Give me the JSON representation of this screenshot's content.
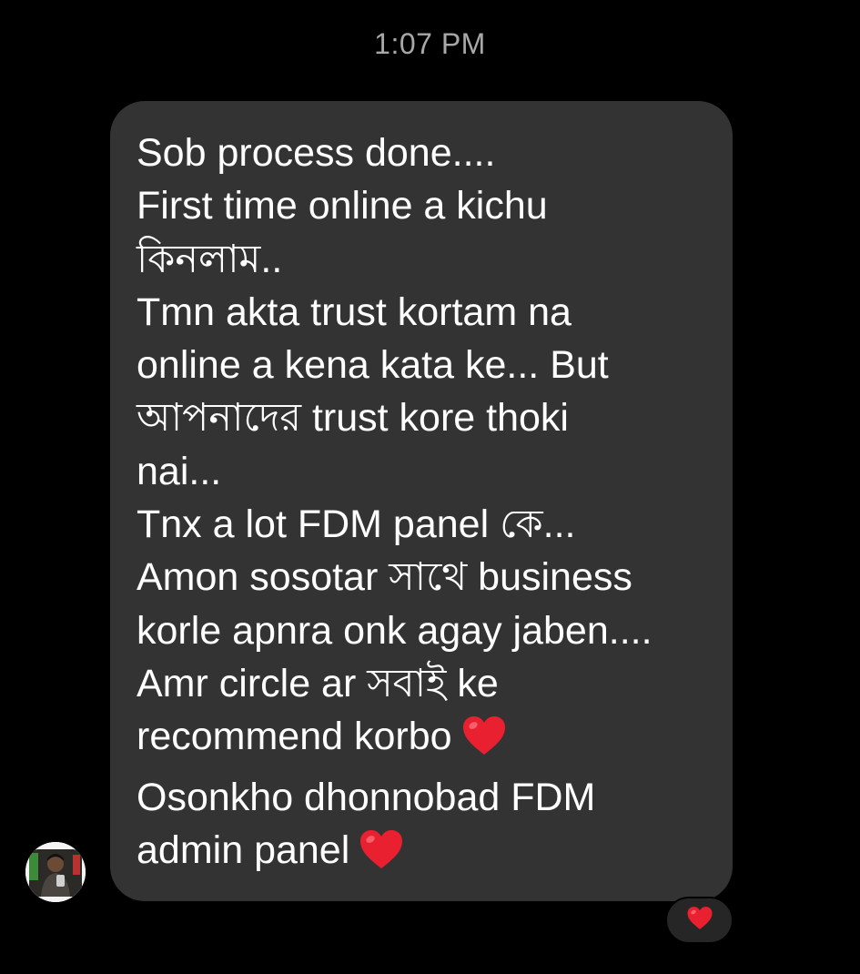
{
  "timestamp": "1:07 PM",
  "message": {
    "lines": [
      "Sob process done....",
      "First time online a kichu",
      "কিনলাম..",
      "Tmn akta trust kortam na",
      "online a kena kata ke... But",
      "আপনাদের trust kore thoki",
      "nai...",
      "Tnx a lot FDM panel কে...",
      "Amon sosotar সাথে business",
      "korle apnra onk agay jaben....",
      "Amr circle ar সবাই ke",
      "recommend korbo",
      "Osonkho dhonnobad FDM",
      "admin panel"
    ],
    "inline_emoji": [
      "heart-emoji",
      "heart-emoji"
    ],
    "colors": {
      "bubble": "#333333",
      "text": "#ffffff",
      "heart": "#e8202f"
    }
  },
  "reaction": {
    "emoji": "heart-emoji"
  },
  "sender": {
    "avatar": "profile-photo"
  }
}
